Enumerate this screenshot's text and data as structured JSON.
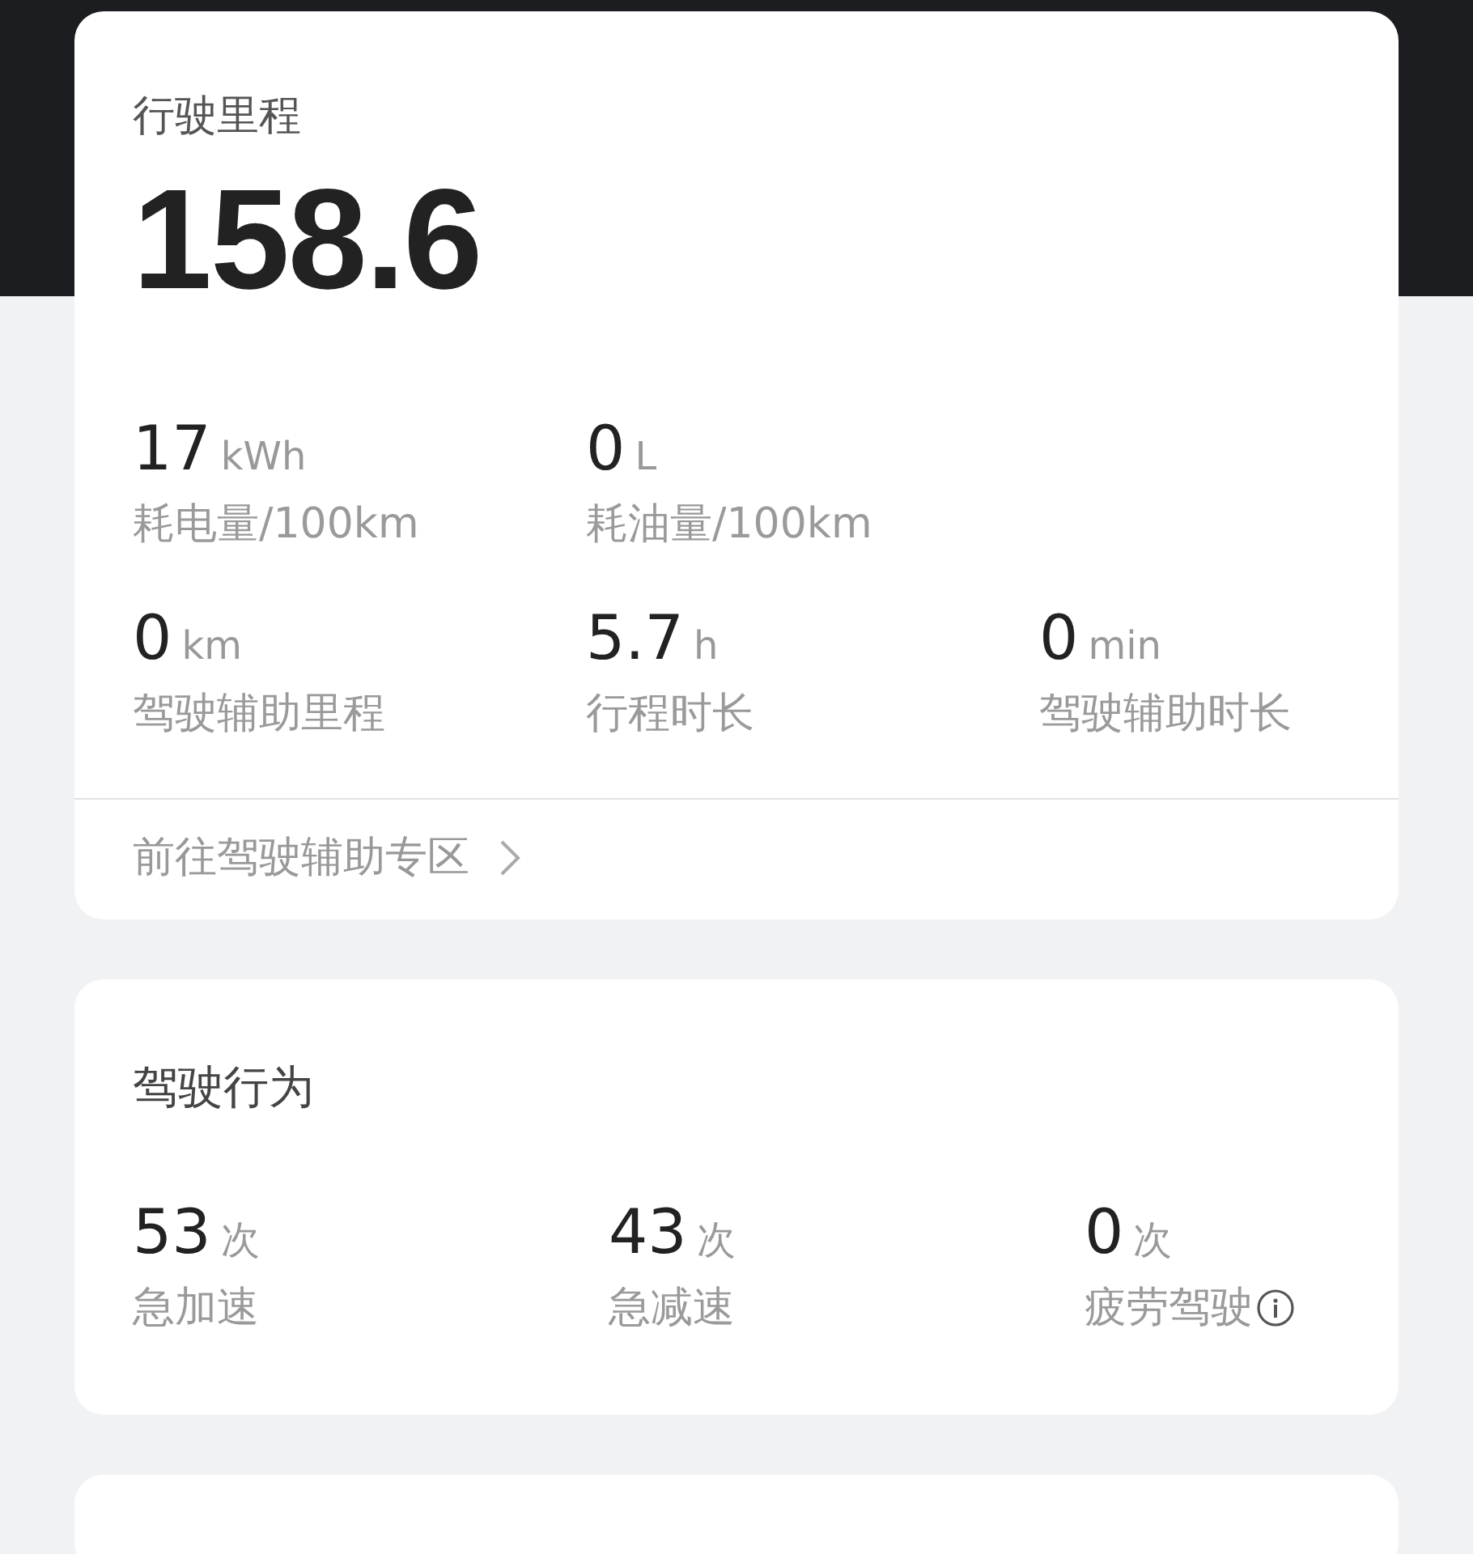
{
  "mileage_card": {
    "title": "行驶里程",
    "total": "158.6",
    "stats": [
      {
        "value": "17",
        "unit": "kWh",
        "label": "耗电量/100km"
      },
      {
        "value": "0",
        "unit": "L",
        "label": "耗油量/100km"
      },
      {
        "value": "0",
        "unit": "km",
        "label": "驾驶辅助里程"
      },
      {
        "value": "5.7",
        "unit": "h",
        "label": "行程时长"
      },
      {
        "value": "0",
        "unit": "min",
        "label": "驾驶辅助时长"
      }
    ],
    "link": "前往驾驶辅助专区"
  },
  "behavior_card": {
    "title": "驾驶行为",
    "stats": [
      {
        "value": "53",
        "unit": "次",
        "label": "急加速",
        "info": false
      },
      {
        "value": "43",
        "unit": "次",
        "label": "急减速",
        "info": false
      },
      {
        "value": "0",
        "unit": "次",
        "label": "疲劳驾驶",
        "info": true
      }
    ]
  }
}
